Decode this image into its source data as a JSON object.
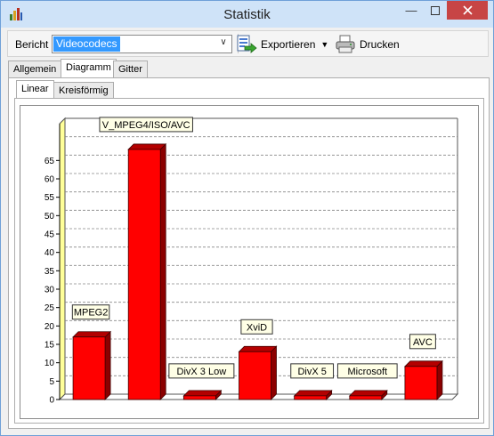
{
  "window": {
    "title": "Statistik"
  },
  "toolbar": {
    "report_label": "Bericht",
    "report_value": "Videocodecs",
    "export_label": "Exportieren",
    "print_label": "Drucken"
  },
  "tabs": [
    "Allgemein",
    "Diagramm",
    "Gitter"
  ],
  "subtabs": [
    "Linear",
    "Kreisförmig"
  ],
  "chart_data": {
    "type": "bar",
    "categories": [
      "MPEG2",
      "V_MPEG4/ISO/AVC",
      "DivX 3 Low",
      "XviD",
      "DivX 5",
      "Microsoft",
      "AVC"
    ],
    "values": [
      17,
      68,
      1,
      13,
      1,
      1,
      9
    ],
    "yticks": [
      0,
      5,
      10,
      15,
      20,
      25,
      30,
      35,
      40,
      45,
      50,
      55,
      60,
      65
    ],
    "ylim": [
      0,
      75
    ],
    "grid": true,
    "colors": {
      "bar": "#ff0000",
      "bar_side": "#8b0000",
      "bar_top": "#b30000",
      "wall": "#ffff99",
      "label_bg": "#ffffe6"
    }
  }
}
